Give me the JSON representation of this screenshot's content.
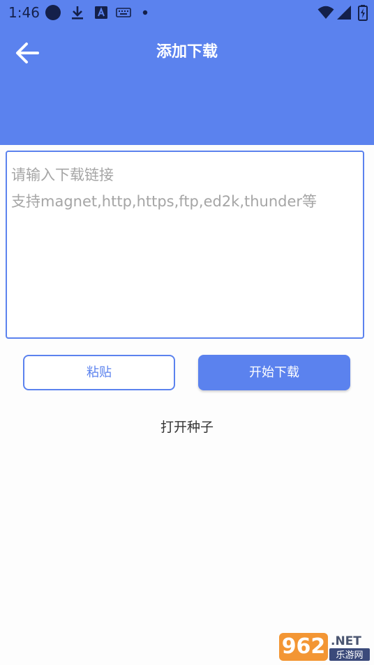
{
  "status_bar": {
    "time": "1:46",
    "icons": [
      "notification-dot-icon",
      "download-icon",
      "font-a-icon",
      "keyboard-icon",
      "more-dot-icon",
      "wifi-icon",
      "signal-icon",
      "battery-charging-icon"
    ]
  },
  "app_bar": {
    "title": "添加下载",
    "back_icon": "arrow-left-icon"
  },
  "input": {
    "placeholder": "请输入下载链接\n支持magnet,http,https,ftp,ed2k,thunder等",
    "value": ""
  },
  "buttons": {
    "paste_label": "粘贴",
    "start_label": "开始下载"
  },
  "links": {
    "open_torrent": "打开种子"
  },
  "watermark": {
    "number": "962",
    "suffix": ".NET",
    "subtitle": "乐游网"
  },
  "colors": {
    "primary": "#5b82ee",
    "background": "#fdfdfd",
    "placeholder": "#a5a5a5",
    "cursor": "#1b8a6b"
  }
}
